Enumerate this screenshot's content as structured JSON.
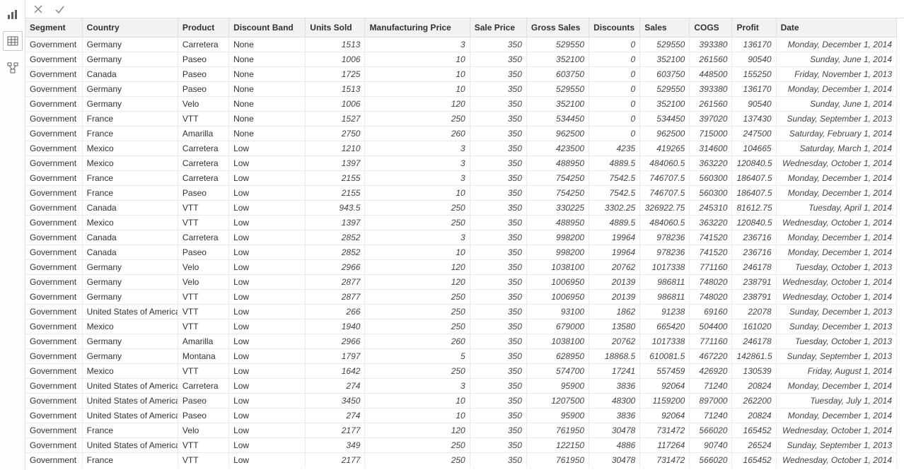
{
  "rail": {
    "report_tooltip": "Report view",
    "data_tooltip": "Data view",
    "model_tooltip": "Model view"
  },
  "columns": [
    {
      "key": "segment",
      "label": "Segment",
      "cls": "txt c0"
    },
    {
      "key": "country",
      "label": "Country",
      "cls": "txt c1"
    },
    {
      "key": "product",
      "label": "Product",
      "cls": "txt c2"
    },
    {
      "key": "discount_band",
      "label": "Discount Band",
      "cls": "txt c3"
    },
    {
      "key": "units_sold",
      "label": "Units Sold",
      "cls": "num c4"
    },
    {
      "key": "mfg_price",
      "label": "Manufacturing Price",
      "cls": "num c5"
    },
    {
      "key": "sale_price",
      "label": "Sale Price",
      "cls": "num c6"
    },
    {
      "key": "gross_sales",
      "label": "Gross Sales",
      "cls": "num c7"
    },
    {
      "key": "discounts",
      "label": "Discounts",
      "cls": "num c8"
    },
    {
      "key": "sales",
      "label": "Sales",
      "cls": "num c9"
    },
    {
      "key": "cogs",
      "label": "COGS",
      "cls": "num c10"
    },
    {
      "key": "profit",
      "label": "Profit",
      "cls": "num c11"
    },
    {
      "key": "date",
      "label": "Date",
      "cls": "date c12"
    }
  ],
  "rows": [
    {
      "segment": "Government",
      "country": "Germany",
      "product": "Carretera",
      "discount_band": "None",
      "units_sold": "1513",
      "mfg_price": "3",
      "sale_price": "350",
      "gross_sales": "529550",
      "discounts": "0",
      "sales": "529550",
      "cogs": "393380",
      "profit": "136170",
      "date": "Monday, December 1, 2014"
    },
    {
      "segment": "Government",
      "country": "Germany",
      "product": "Paseo",
      "discount_band": "None",
      "units_sold": "1006",
      "mfg_price": "10",
      "sale_price": "350",
      "gross_sales": "352100",
      "discounts": "0",
      "sales": "352100",
      "cogs": "261560",
      "profit": "90540",
      "date": "Sunday, June 1, 2014"
    },
    {
      "segment": "Government",
      "country": "Canada",
      "product": "Paseo",
      "discount_band": "None",
      "units_sold": "1725",
      "mfg_price": "10",
      "sale_price": "350",
      "gross_sales": "603750",
      "discounts": "0",
      "sales": "603750",
      "cogs": "448500",
      "profit": "155250",
      "date": "Friday, November 1, 2013"
    },
    {
      "segment": "Government",
      "country": "Germany",
      "product": "Paseo",
      "discount_band": "None",
      "units_sold": "1513",
      "mfg_price": "10",
      "sale_price": "350",
      "gross_sales": "529550",
      "discounts": "0",
      "sales": "529550",
      "cogs": "393380",
      "profit": "136170",
      "date": "Monday, December 1, 2014"
    },
    {
      "segment": "Government",
      "country": "Germany",
      "product": "Velo",
      "discount_band": "None",
      "units_sold": "1006",
      "mfg_price": "120",
      "sale_price": "350",
      "gross_sales": "352100",
      "discounts": "0",
      "sales": "352100",
      "cogs": "261560",
      "profit": "90540",
      "date": "Sunday, June 1, 2014"
    },
    {
      "segment": "Government",
      "country": "France",
      "product": "VTT",
      "discount_band": "None",
      "units_sold": "1527",
      "mfg_price": "250",
      "sale_price": "350",
      "gross_sales": "534450",
      "discounts": "0",
      "sales": "534450",
      "cogs": "397020",
      "profit": "137430",
      "date": "Sunday, September 1, 2013"
    },
    {
      "segment": "Government",
      "country": "France",
      "product": "Amarilla",
      "discount_band": "None",
      "units_sold": "2750",
      "mfg_price": "260",
      "sale_price": "350",
      "gross_sales": "962500",
      "discounts": "0",
      "sales": "962500",
      "cogs": "715000",
      "profit": "247500",
      "date": "Saturday, February 1, 2014"
    },
    {
      "segment": "Government",
      "country": "Mexico",
      "product": "Carretera",
      "discount_band": "Low",
      "units_sold": "1210",
      "mfg_price": "3",
      "sale_price": "350",
      "gross_sales": "423500",
      "discounts": "4235",
      "sales": "419265",
      "cogs": "314600",
      "profit": "104665",
      "date": "Saturday, March 1, 2014"
    },
    {
      "segment": "Government",
      "country": "Mexico",
      "product": "Carretera",
      "discount_band": "Low",
      "units_sold": "1397",
      "mfg_price": "3",
      "sale_price": "350",
      "gross_sales": "488950",
      "discounts": "4889.5",
      "sales": "484060.5",
      "cogs": "363220",
      "profit": "120840.5",
      "date": "Wednesday, October 1, 2014"
    },
    {
      "segment": "Government",
      "country": "France",
      "product": "Carretera",
      "discount_band": "Low",
      "units_sold": "2155",
      "mfg_price": "3",
      "sale_price": "350",
      "gross_sales": "754250",
      "discounts": "7542.5",
      "sales": "746707.5",
      "cogs": "560300",
      "profit": "186407.5",
      "date": "Monday, December 1, 2014"
    },
    {
      "segment": "Government",
      "country": "France",
      "product": "Paseo",
      "discount_band": "Low",
      "units_sold": "2155",
      "mfg_price": "10",
      "sale_price": "350",
      "gross_sales": "754250",
      "discounts": "7542.5",
      "sales": "746707.5",
      "cogs": "560300",
      "profit": "186407.5",
      "date": "Monday, December 1, 2014"
    },
    {
      "segment": "Government",
      "country": "Canada",
      "product": "VTT",
      "discount_band": "Low",
      "units_sold": "943.5",
      "mfg_price": "250",
      "sale_price": "350",
      "gross_sales": "330225",
      "discounts": "3302.25",
      "sales": "326922.75",
      "cogs": "245310",
      "profit": "81612.75",
      "date": "Tuesday, April 1, 2014"
    },
    {
      "segment": "Government",
      "country": "Mexico",
      "product": "VTT",
      "discount_band": "Low",
      "units_sold": "1397",
      "mfg_price": "250",
      "sale_price": "350",
      "gross_sales": "488950",
      "discounts": "4889.5",
      "sales": "484060.5",
      "cogs": "363220",
      "profit": "120840.5",
      "date": "Wednesday, October 1, 2014"
    },
    {
      "segment": "Government",
      "country": "Canada",
      "product": "Carretera",
      "discount_band": "Low",
      "units_sold": "2852",
      "mfg_price": "3",
      "sale_price": "350",
      "gross_sales": "998200",
      "discounts": "19964",
      "sales": "978236",
      "cogs": "741520",
      "profit": "236716",
      "date": "Monday, December 1, 2014"
    },
    {
      "segment": "Government",
      "country": "Canada",
      "product": "Paseo",
      "discount_band": "Low",
      "units_sold": "2852",
      "mfg_price": "10",
      "sale_price": "350",
      "gross_sales": "998200",
      "discounts": "19964",
      "sales": "978236",
      "cogs": "741520",
      "profit": "236716",
      "date": "Monday, December 1, 2014"
    },
    {
      "segment": "Government",
      "country": "Germany",
      "product": "Velo",
      "discount_band": "Low",
      "units_sold": "2966",
      "mfg_price": "120",
      "sale_price": "350",
      "gross_sales": "1038100",
      "discounts": "20762",
      "sales": "1017338",
      "cogs": "771160",
      "profit": "246178",
      "date": "Tuesday, October 1, 2013"
    },
    {
      "segment": "Government",
      "country": "Germany",
      "product": "Velo",
      "discount_band": "Low",
      "units_sold": "2877",
      "mfg_price": "120",
      "sale_price": "350",
      "gross_sales": "1006950",
      "discounts": "20139",
      "sales": "986811",
      "cogs": "748020",
      "profit": "238791",
      "date": "Wednesday, October 1, 2014"
    },
    {
      "segment": "Government",
      "country": "Germany",
      "product": "VTT",
      "discount_band": "Low",
      "units_sold": "2877",
      "mfg_price": "250",
      "sale_price": "350",
      "gross_sales": "1006950",
      "discounts": "20139",
      "sales": "986811",
      "cogs": "748020",
      "profit": "238791",
      "date": "Wednesday, October 1, 2014"
    },
    {
      "segment": "Government",
      "country": "United States of America",
      "product": "VTT",
      "discount_band": "Low",
      "units_sold": "266",
      "mfg_price": "250",
      "sale_price": "350",
      "gross_sales": "93100",
      "discounts": "1862",
      "sales": "91238",
      "cogs": "69160",
      "profit": "22078",
      "date": "Sunday, December 1, 2013"
    },
    {
      "segment": "Government",
      "country": "Mexico",
      "product": "VTT",
      "discount_band": "Low",
      "units_sold": "1940",
      "mfg_price": "250",
      "sale_price": "350",
      "gross_sales": "679000",
      "discounts": "13580",
      "sales": "665420",
      "cogs": "504400",
      "profit": "161020",
      "date": "Sunday, December 1, 2013"
    },
    {
      "segment": "Government",
      "country": "Germany",
      "product": "Amarilla",
      "discount_band": "Low",
      "units_sold": "2966",
      "mfg_price": "260",
      "sale_price": "350",
      "gross_sales": "1038100",
      "discounts": "20762",
      "sales": "1017338",
      "cogs": "771160",
      "profit": "246178",
      "date": "Tuesday, October 1, 2013"
    },
    {
      "segment": "Government",
      "country": "Germany",
      "product": "Montana",
      "discount_band": "Low",
      "units_sold": "1797",
      "mfg_price": "5",
      "sale_price": "350",
      "gross_sales": "628950",
      "discounts": "18868.5",
      "sales": "610081.5",
      "cogs": "467220",
      "profit": "142861.5",
      "date": "Sunday, September 1, 2013"
    },
    {
      "segment": "Government",
      "country": "Mexico",
      "product": "VTT",
      "discount_band": "Low",
      "units_sold": "1642",
      "mfg_price": "250",
      "sale_price": "350",
      "gross_sales": "574700",
      "discounts": "17241",
      "sales": "557459",
      "cogs": "426920",
      "profit": "130539",
      "date": "Friday, August 1, 2014"
    },
    {
      "segment": "Government",
      "country": "United States of America",
      "product": "Carretera",
      "discount_band": "Low",
      "units_sold": "274",
      "mfg_price": "3",
      "sale_price": "350",
      "gross_sales": "95900",
      "discounts": "3836",
      "sales": "92064",
      "cogs": "71240",
      "profit": "20824",
      "date": "Monday, December 1, 2014"
    },
    {
      "segment": "Government",
      "country": "United States of America",
      "product": "Paseo",
      "discount_band": "Low",
      "units_sold": "3450",
      "mfg_price": "10",
      "sale_price": "350",
      "gross_sales": "1207500",
      "discounts": "48300",
      "sales": "1159200",
      "cogs": "897000",
      "profit": "262200",
      "date": "Tuesday, July 1, 2014"
    },
    {
      "segment": "Government",
      "country": "United States of America",
      "product": "Paseo",
      "discount_band": "Low",
      "units_sold": "274",
      "mfg_price": "10",
      "sale_price": "350",
      "gross_sales": "95900",
      "discounts": "3836",
      "sales": "92064",
      "cogs": "71240",
      "profit": "20824",
      "date": "Monday, December 1, 2014"
    },
    {
      "segment": "Government",
      "country": "France",
      "product": "Velo",
      "discount_band": "Low",
      "units_sold": "2177",
      "mfg_price": "120",
      "sale_price": "350",
      "gross_sales": "761950",
      "discounts": "30478",
      "sales": "731472",
      "cogs": "566020",
      "profit": "165452",
      "date": "Wednesday, October 1, 2014"
    },
    {
      "segment": "Government",
      "country": "United States of America",
      "product": "VTT",
      "discount_band": "Low",
      "units_sold": "349",
      "mfg_price": "250",
      "sale_price": "350",
      "gross_sales": "122150",
      "discounts": "4886",
      "sales": "117264",
      "cogs": "90740",
      "profit": "26524",
      "date": "Sunday, September 1, 2013"
    },
    {
      "segment": "Government",
      "country": "France",
      "product": "VTT",
      "discount_band": "Low",
      "units_sold": "2177",
      "mfg_price": "250",
      "sale_price": "350",
      "gross_sales": "761950",
      "discounts": "30478",
      "sales": "731472",
      "cogs": "566020",
      "profit": "165452",
      "date": "Wednesday, October 1, 2014"
    }
  ]
}
